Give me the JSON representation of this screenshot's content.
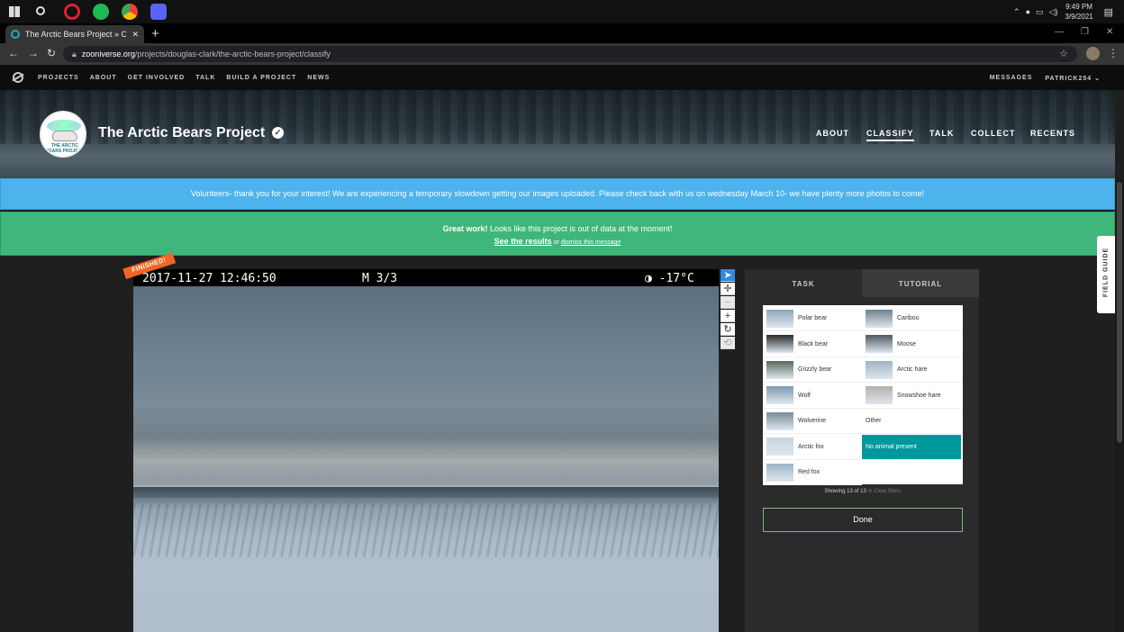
{
  "taskbar": {
    "icons": [
      "windows-icon",
      "search-icon",
      "opera-icon",
      "spotify-icon",
      "chrome-icon",
      "discord-icon"
    ],
    "time": "9:49 PM",
    "date": "3/9/2021"
  },
  "browser": {
    "tab_title": "The Arctic Bears Project » Classify",
    "url_host": "zooniverse.org",
    "url_path": "/projects/douglas-clark/the-arctic-bears-project/classify"
  },
  "zoonav": {
    "links": [
      "PROJECTS",
      "ABOUT",
      "GET INVOLVED",
      "TALK",
      "BUILD A PROJECT",
      "NEWS"
    ],
    "messages": "MESSAGES",
    "user": "PATRICK254"
  },
  "project": {
    "title": "The Arctic Bears Project",
    "avatar_text": "THE ARCTIC BEARS PROJECT",
    "nav": [
      "ABOUT",
      "CLASSIFY",
      "TALK",
      "COLLECT",
      "RECENTS"
    ],
    "active_nav": "CLASSIFY"
  },
  "banners": {
    "blue": "Volunteers- thank you for your interest! We are experiencing a temporary slowdown getting our images uploaded. Please check back with us on wednesday March 10- we have plenty more photos to come!",
    "green_bold": "Great work!",
    "green_text": " Looks like this project is out of data at the moment!",
    "see_results": "See the results",
    "or": " or ",
    "dismiss": "dismiss this message"
  },
  "field_guide": "FIELD GUIDE",
  "subject": {
    "finished": "FINISHED!",
    "timestamp": "2017-11-27  12:46:50",
    "frame": "M 3/3",
    "temperature": "◑  -17°C"
  },
  "toolbar": [
    "pointer",
    "move",
    "zoom-out",
    "zoom-in",
    "rotate",
    "reset"
  ],
  "task": {
    "tab_task": "TASK",
    "tab_tutorial": "TUTORIAL",
    "choices": [
      {
        "label": "Polar bear",
        "thumb": "#8fa6b8"
      },
      {
        "label": "Caribou",
        "thumb": "#6f8090"
      },
      {
        "label": "Black bear",
        "thumb": "#2a2a2a"
      },
      {
        "label": "Moose",
        "thumb": "#505860"
      },
      {
        "label": "Grizzly bear",
        "thumb": "#5b6a5a"
      },
      {
        "label": "Arctic hare",
        "thumb": "#a0b4c4"
      },
      {
        "label": "Wolf",
        "thumb": "#7d9ab0"
      },
      {
        "label": "Snowshoe hare",
        "thumb": "#b5b0a8"
      },
      {
        "label": "Wolverine",
        "thumb": "#7c8a96"
      },
      {
        "label": "Other",
        "thumb": ""
      },
      {
        "label": "Arctic fox",
        "thumb": "#c8d4de"
      },
      {
        "label": "No animal present",
        "thumb": ""
      },
      {
        "label": "Red fox",
        "thumb": "#9fb6c8"
      }
    ],
    "selected": "No animal present",
    "showing": "Showing 13 of 13",
    "clear_filters": "⊘ Clear filters",
    "done": "Done"
  }
}
